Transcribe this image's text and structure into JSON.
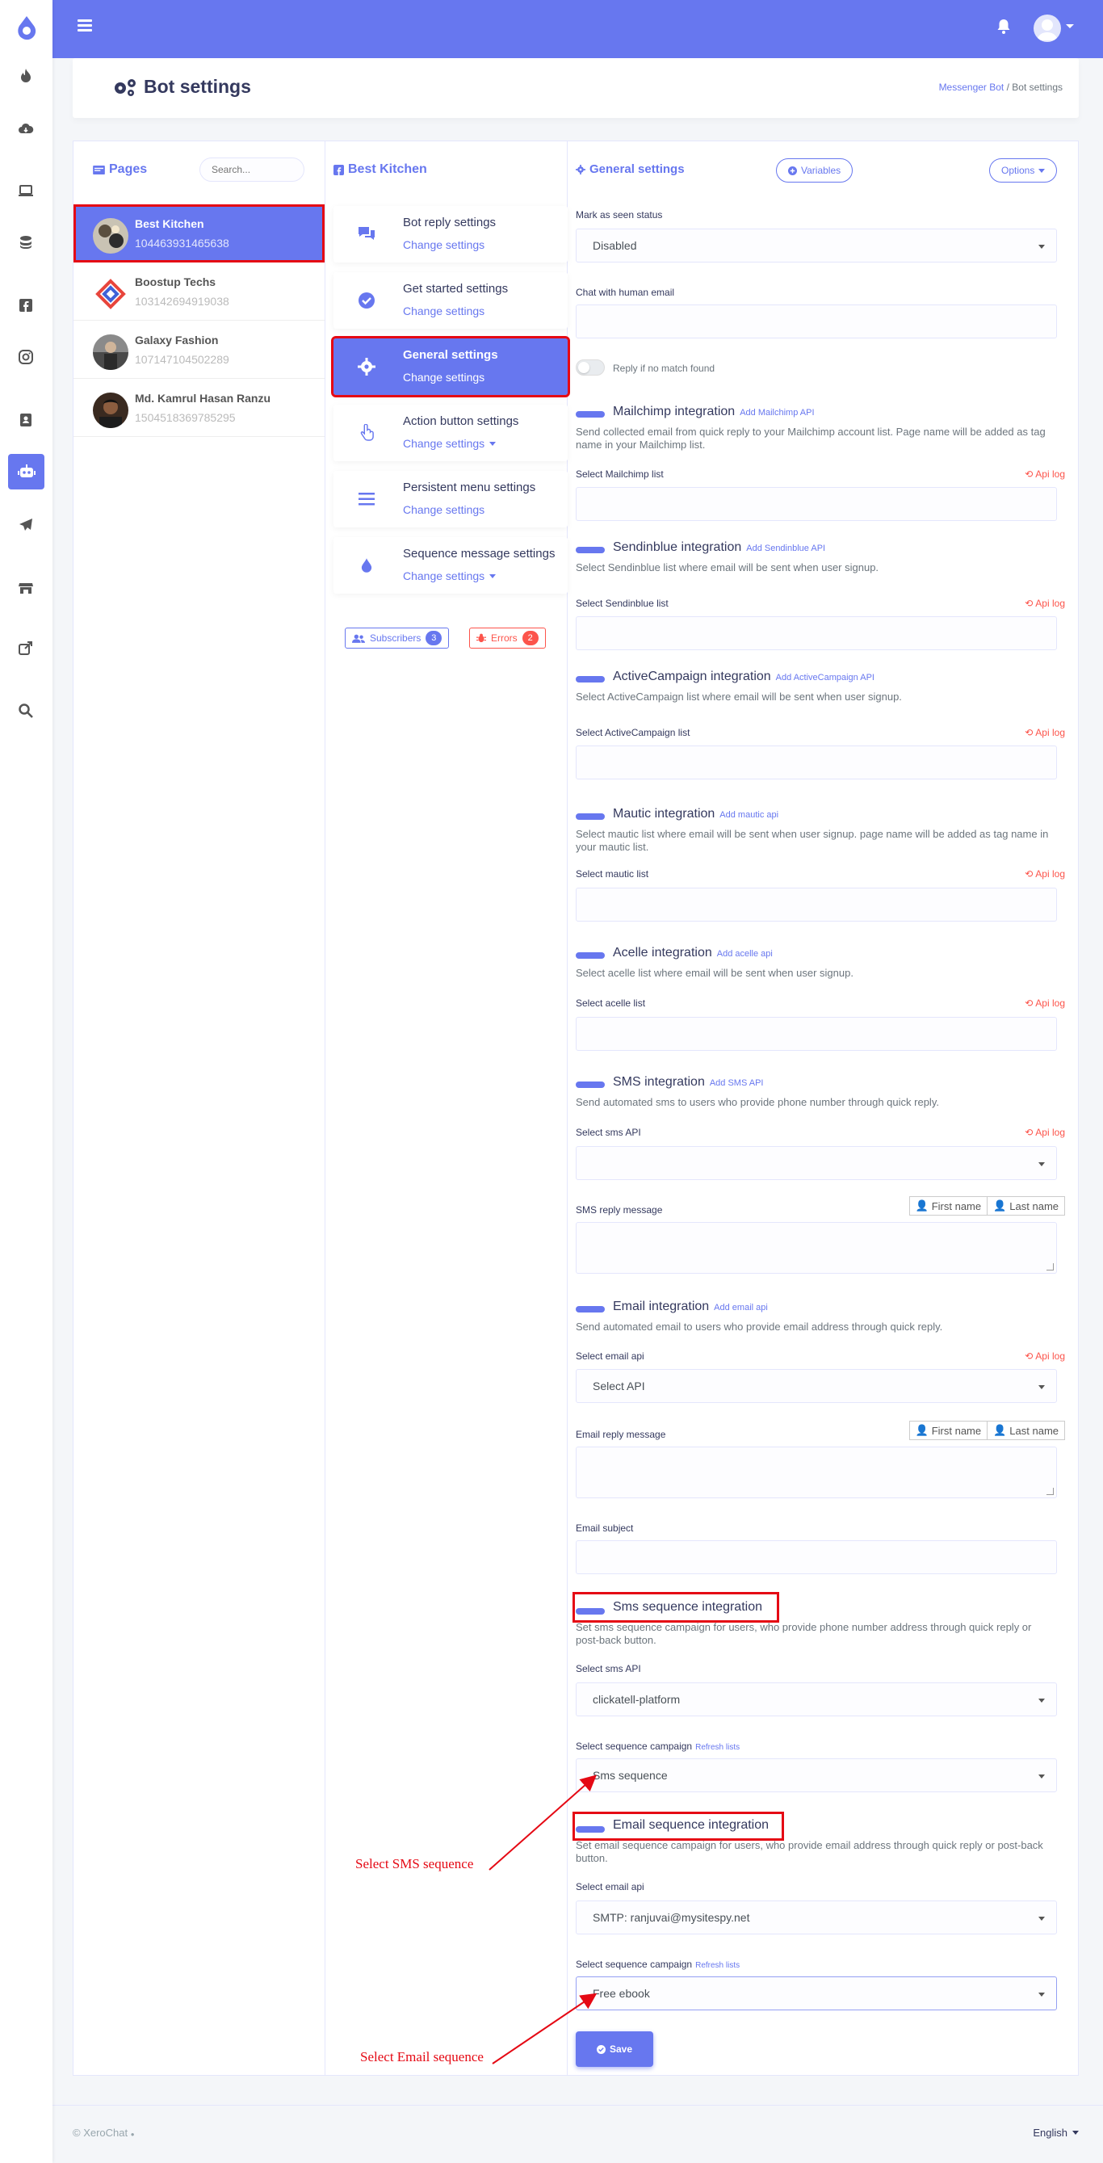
{
  "header": {
    "title": "Bot settings",
    "breadcrumb_link": "Messenger Bot",
    "breadcrumb_current": "Bot settings"
  },
  "pages_panel": {
    "title": "Pages",
    "search_placeholder": "Search...",
    "pages": [
      {
        "name": "Best Kitchen",
        "id": "104463931465638",
        "active": true
      },
      {
        "name": "Boostup Techs",
        "id": "103142694919038",
        "active": false
      },
      {
        "name": "Galaxy Fashion",
        "id": "107147104502289",
        "active": false
      },
      {
        "name": "Md. Kamrul Hasan Ranzu",
        "id": "1504518369785295",
        "active": false
      }
    ]
  },
  "menu_panel": {
    "title": "Best Kitchen",
    "items": [
      {
        "title": "Bot reply settings",
        "link": "Change settings",
        "icon": "comments-icon"
      },
      {
        "title": "Get started settings",
        "link": "Change settings",
        "icon": "check-circle-icon"
      },
      {
        "title": "General settings",
        "link": "Change settings",
        "icon": "gear-icon",
        "active": true
      },
      {
        "title": "Action button settings",
        "link": "Change settings",
        "icon": "hand-pointer-icon",
        "caret": true
      },
      {
        "title": "Persistent menu settings",
        "link": "Change settings",
        "icon": "bars-icon"
      },
      {
        "title": "Sequence message settings",
        "link": "Change settings",
        "icon": "drop-icon",
        "caret": true
      }
    ],
    "subscribers_label": "Subscribers",
    "subscribers_count": "3",
    "errors_label": "Errors",
    "errors_count": "2"
  },
  "general": {
    "title": "General settings",
    "variables_btn": "Variables",
    "options_btn": "Options",
    "mark_seen_label": "Mark as seen status",
    "mark_seen_value": "Disabled",
    "chat_human_label": "Chat with human email",
    "reply_no_match": "Reply if no match found",
    "api_log": "Api log",
    "mailchimp": {
      "title": "Mailchimp integration",
      "link": "Add Mailchimp API",
      "desc": "Send collected email from quick reply to your Mailchimp account list. Page name will be added as tag name in your Mailchimp list.",
      "select_label": "Select Mailchimp list"
    },
    "sendinblue": {
      "title": "Sendinblue integration",
      "link": "Add Sendinblue API",
      "desc": "Select Sendinblue list where email will be sent when user signup.",
      "select_label": "Select Sendinblue list"
    },
    "activecampaign": {
      "title": "ActiveCampaign integration",
      "link": "Add ActiveCampaign API",
      "desc": "Select ActiveCampaign list where email will be sent when user signup.",
      "select_label": "Select ActiveCampaign list"
    },
    "mautic": {
      "title": "Mautic integration",
      "link": "Add mautic api",
      "desc": "Select mautic list where email will be sent when user signup. page name will be added as tag name in your mautic list.",
      "select_label": "Select mautic list"
    },
    "acelle": {
      "title": "Acelle integration",
      "link": "Add acelle api",
      "desc": "Select acelle list where email will be sent when user signup.",
      "select_label": "Select acelle list"
    },
    "sms": {
      "title": "SMS integration",
      "link": "Add SMS API",
      "desc": "Send automated sms to users who provide phone number through quick reply.",
      "select_label": "Select sms API",
      "reply_label": "SMS reply message"
    },
    "email": {
      "title": "Email integration",
      "link": "Add email api",
      "desc": "Send automated email to users who provide email address through quick reply.",
      "select_label": "Select email api",
      "select_value": "Select API",
      "reply_label": "Email reply message",
      "subject_label": "Email subject"
    },
    "first_name": "First name",
    "last_name": "Last name",
    "sms_sequence": {
      "title": "Sms sequence integration",
      "desc": "Set sms sequence campaign for users, who provide phone number address through quick reply or post-back button.",
      "api_label": "Select sms API",
      "api_value": "clickatell-platform",
      "campaign_label": "Select sequence campaign",
      "refresh": "Refresh lists",
      "campaign_value": "Sms sequence"
    },
    "email_sequence": {
      "title": "Email sequence integration",
      "desc": "Set email sequence campaign for users, who provide email address through quick reply or post-back button.",
      "api_label": "Select email api",
      "api_value": "SMTP: ranjuvai@mysitespy.net",
      "campaign_label": "Select sequence campaign",
      "refresh": "Refresh lists",
      "campaign_value": "Free ebook"
    },
    "save_btn": "Save"
  },
  "annotations": {
    "sms": "Select SMS sequence",
    "email": "Select Email sequence"
  },
  "footer": {
    "copyright": "© XeroChat",
    "language": "English"
  },
  "colors": {
    "primary": "#6777ef",
    "danger": "#fc544b",
    "highlight": "#e50914"
  }
}
